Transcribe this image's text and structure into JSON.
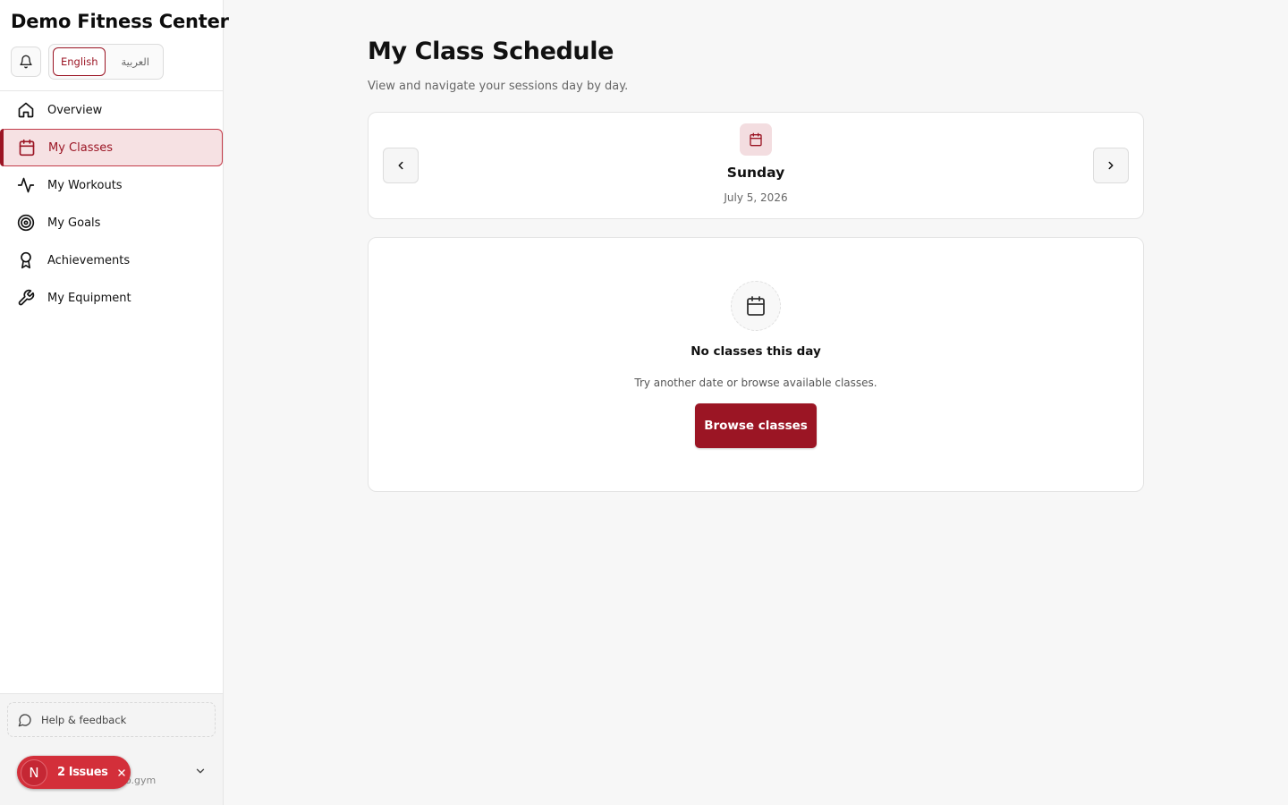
{
  "brand": {
    "name": "Demo Fitness Center"
  },
  "header": {
    "language": {
      "active": "English",
      "other": "العربية"
    }
  },
  "sidebar": {
    "items": [
      {
        "label": "Overview",
        "icon": "home-icon",
        "active": false
      },
      {
        "label": "My Classes",
        "icon": "calendar-icon",
        "active": true
      },
      {
        "label": "My Workouts",
        "icon": "activity-icon",
        "active": false
      },
      {
        "label": "My Goals",
        "icon": "target-icon",
        "active": false
      },
      {
        "label": "Achievements",
        "icon": "award-icon",
        "active": false
      },
      {
        "label": "My Equipment",
        "icon": "wrench-icon",
        "active": false
      }
    ],
    "help_label": "Help & feedback",
    "user_email_fragment": "o.gym"
  },
  "issues_badge": {
    "avatar_letter": "N",
    "label": "2 Issues"
  },
  "main": {
    "title": "My Class Schedule",
    "subtitle": "View and navigate your sessions day by day.",
    "day": {
      "name": "Sunday",
      "date": "July 5, 2026"
    },
    "empty_state": {
      "title": "No classes this day",
      "text": "Try another date or browse available classes.",
      "button_label": "Browse classes"
    }
  },
  "colors": {
    "accent": "#9b1524",
    "accent_light": "#f6e1e3",
    "issues_red": "#d32f3a",
    "background": "#f7f7f7"
  }
}
